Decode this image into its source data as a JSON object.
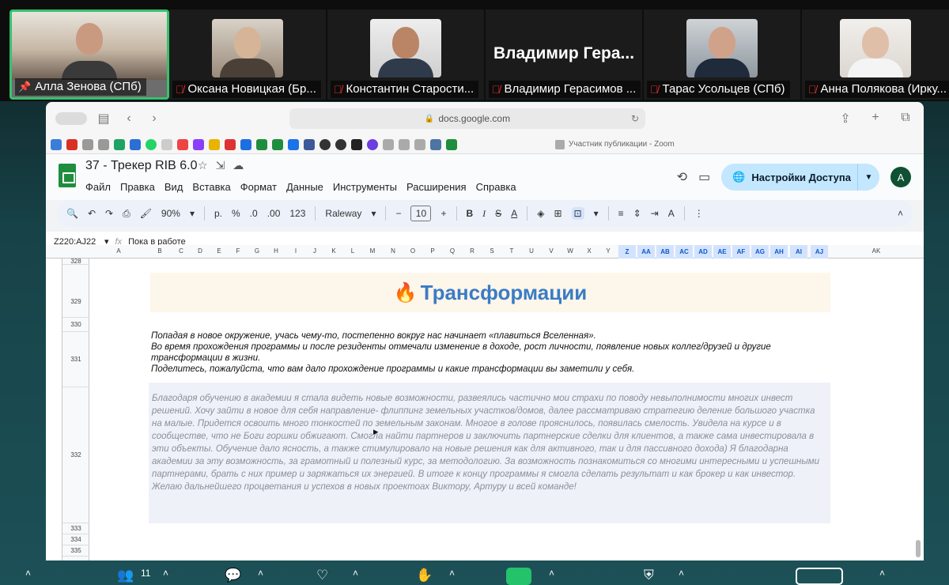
{
  "participants": [
    {
      "name": "Алла Зенова (СПб)",
      "active": true
    },
    {
      "name": "Оксана Новицкая (Бр...",
      "active": false
    },
    {
      "name": "Константин Старости...",
      "active": false
    },
    {
      "name": "Владимир Герасимов ...",
      "big_name": "Владимир Гера...",
      "active": false
    },
    {
      "name": "Тарас Усольцев (СПб)",
      "active": false
    },
    {
      "name": "Анна Полякова (Ирку...",
      "active": false
    }
  ],
  "browser": {
    "url": "docs.google.com",
    "other_tab": "Участник публикации - Zoom"
  },
  "doc": {
    "title": "37 - Трекер RIB 6.0",
    "menu": [
      "Файл",
      "Правка",
      "Вид",
      "Вставка",
      "Формат",
      "Данные",
      "Инструменты",
      "Расширения",
      "Справка"
    ],
    "share_label": "Настройки Доступа",
    "avatar_letter": "A"
  },
  "toolbar": {
    "zoom": "90%",
    "percent": "%",
    "dec_minus": ".0",
    "dec_plus": ".00",
    "number_format": "123",
    "currency": "р.",
    "font": "Raleway",
    "font_size": "10"
  },
  "formula_bar": {
    "cell_ref": "Z220:AJ22",
    "value": "Пока в работе"
  },
  "columns": [
    "A",
    "B",
    "C",
    "D",
    "E",
    "F",
    "G",
    "H",
    "I",
    "J",
    "K",
    "L",
    "M",
    "N",
    "O",
    "P",
    "Q",
    "R",
    "S",
    "T",
    "U",
    "V",
    "W",
    "X",
    "Y",
    "Z",
    "AA",
    "AB",
    "AC",
    "AD",
    "AE",
    "AF",
    "AG",
    "AH",
    "AI",
    "AJ",
    "AK"
  ],
  "rows": [
    "328",
    "329",
    "330",
    "331",
    "332",
    "333",
    "334",
    "335"
  ],
  "content": {
    "fire": "🔥",
    "heading": "Трансформации",
    "intro": [
      "Попадая в новое окружение, учась чему-то, постепенно вокруг нас начинает «плавиться Вселенная».",
      "Во время прохождения программы и после резиденты отмечали изменение в доходе, рост личности, появление новых коллег/друзей и другие трансформации в жизни.",
      "Поделитесь, пожалуйста, что вам дало прохождение программы и какие трансформации вы заметили у себя."
    ],
    "answer": "Благодаря обучению в академии я  стала видеть новые возможности, развеялись частично мои страхи по поводу невыполнимости многих инвест решений. Хочу зайти в новое для себя направление- флиппинг земельных участков/домов, далее рассматриваю стратегию  деление большого участка на малые. Придется освоить много тонкостей по земельным законам. Многое в голове прояснилось, появилась смелость. Увидела на курсе и в сообществе, что не Боги горшки обжигают. Смогла найти партнеров и заключить партнерские сделки для клиентов, а также сама инвестировала в эти объекты. Обучение дало ясность, а также стимулировало на новые решения как для активного, так и для  пассивного дохода) Я благодарна академии за эту возможность, за грамотный и полезный курс, за методологию. За возможность познакомиться со многими интересными и успешными партнерами, брать с них пример и заряжаться их энергией. В итоге к концу программы я смогла сделать результат и как брокер и как инвестор. Желаю дальнейшего процветания и успехов в новых проектоах Виктору, Артуру и всей команде!"
  },
  "zoom_bar": {
    "participants_count": "11"
  },
  "colors": {
    "accent_green": "#36c16e",
    "heading_blue": "#3a7cc5",
    "share_bg": "#c2e7ff"
  }
}
